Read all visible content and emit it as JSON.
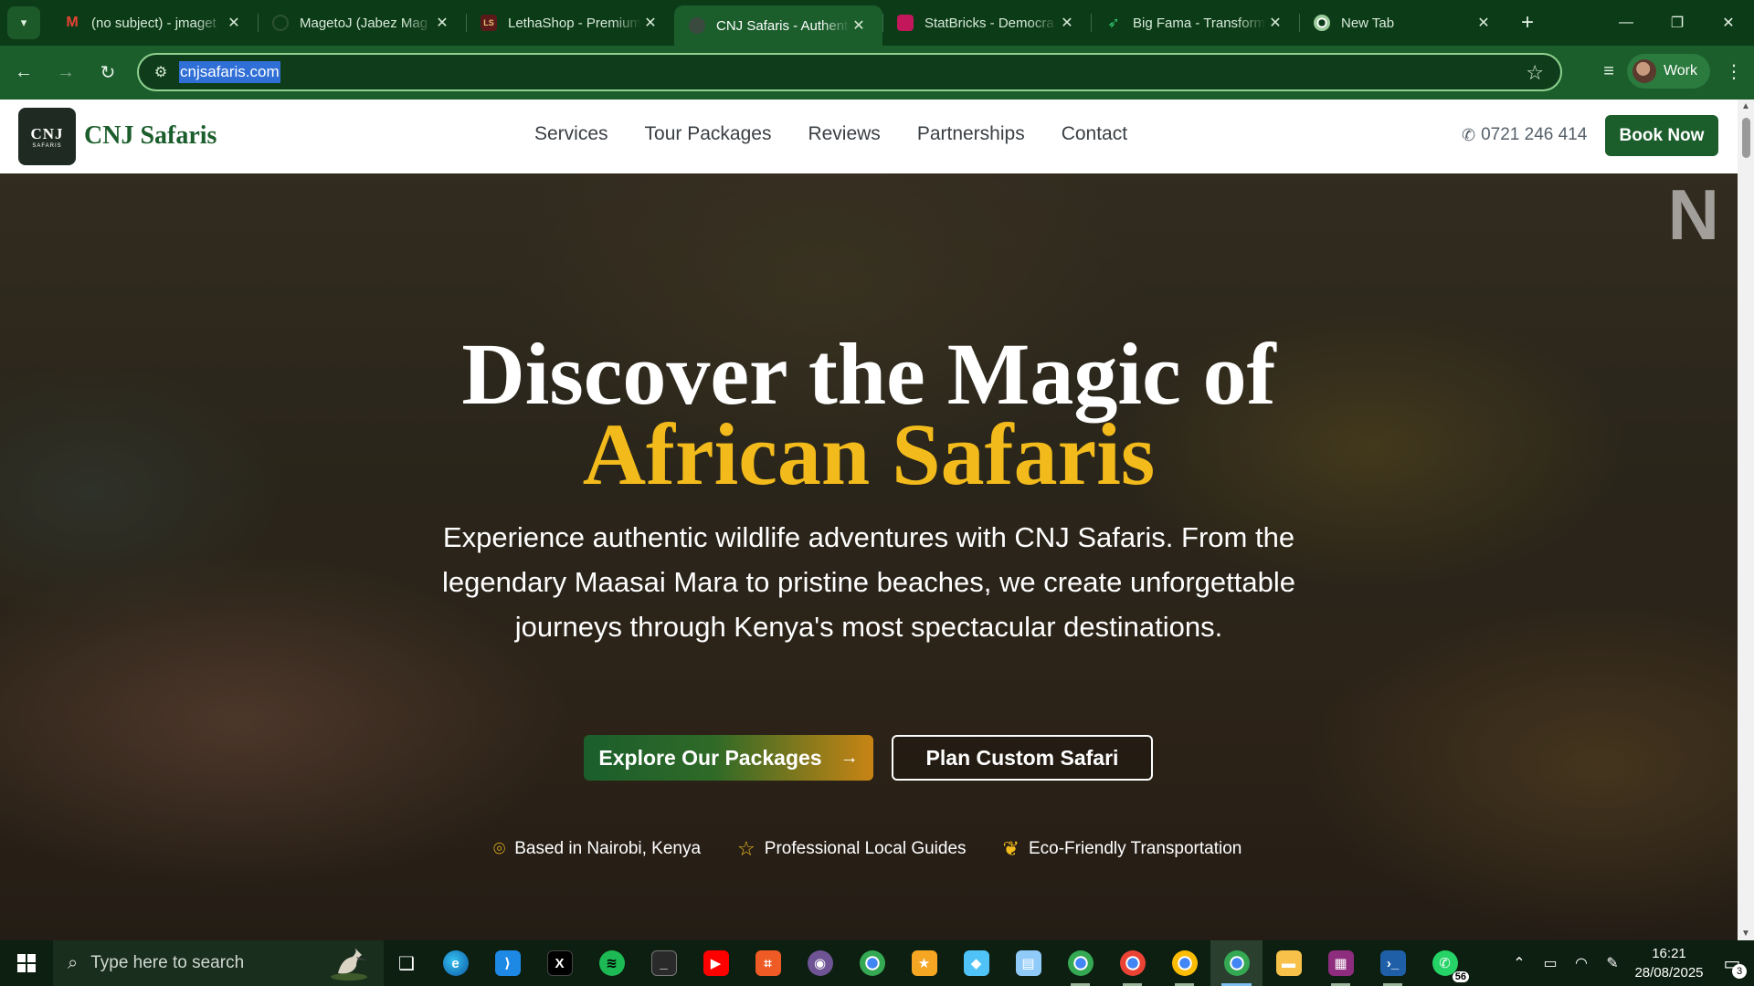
{
  "browser": {
    "tabs": [
      {
        "title": "(no subject) - jmaget",
        "favicon": "gmail-icon",
        "active": false
      },
      {
        "title": "MagetoJ (Jabez Mag",
        "favicon": "github-icon",
        "active": false
      },
      {
        "title": "LethaShop - Premium",
        "favicon": "lethashop-icon",
        "active": false
      },
      {
        "title": "CNJ Safaris - Authent",
        "favicon": "cnj-icon",
        "active": true
      },
      {
        "title": "StatBricks - Democra",
        "favicon": "statbricks-icon",
        "active": false
      },
      {
        "title": "Big Fama - Transform",
        "favicon": "bigfama-icon",
        "active": false
      },
      {
        "title": "New Tab",
        "favicon": "chrome-icon",
        "active": false
      }
    ],
    "url": "cnjsafaris.com",
    "profile_label": "Work"
  },
  "site": {
    "logo_line1": "CNJ",
    "logo_line2": "SAFARIS",
    "brand": "CNJ Safaris",
    "nav": [
      "Services",
      "Tour Packages",
      "Reviews",
      "Partnerships",
      "Contact"
    ],
    "phone": "0721 246 414",
    "book_label": "Book Now"
  },
  "hero": {
    "corner_text": "N",
    "title_line1": "Discover the Magic of",
    "title_line2": "African Safaris",
    "subtitle": "Experience authentic wildlife adventures with CNJ Safaris. From the legendary Maasai Mara to pristine beaches, we create unforgettable journeys through Kenya's most spectacular destinations.",
    "primary_button": "Explore Our Packages",
    "secondary_button": "Plan Custom Safari",
    "features": [
      {
        "icon": "map-pin-icon",
        "label": "Based in Nairobi, Kenya"
      },
      {
        "icon": "star-icon",
        "label": "Professional Local Guides"
      },
      {
        "icon": "leaf-icon",
        "label": "Eco-Friendly Transportation"
      }
    ]
  },
  "taskbar": {
    "search_placeholder": "Type here to search",
    "whatsapp_badge": "56",
    "time": "16:21",
    "date": "28/08/2025",
    "notifications": "3"
  },
  "colors": {
    "browser_frame": "#0c3b18",
    "browser_toolbar": "#1b5e2c",
    "brand_green": "#1b5e2c",
    "accent_gold": "#f2bb1b"
  }
}
